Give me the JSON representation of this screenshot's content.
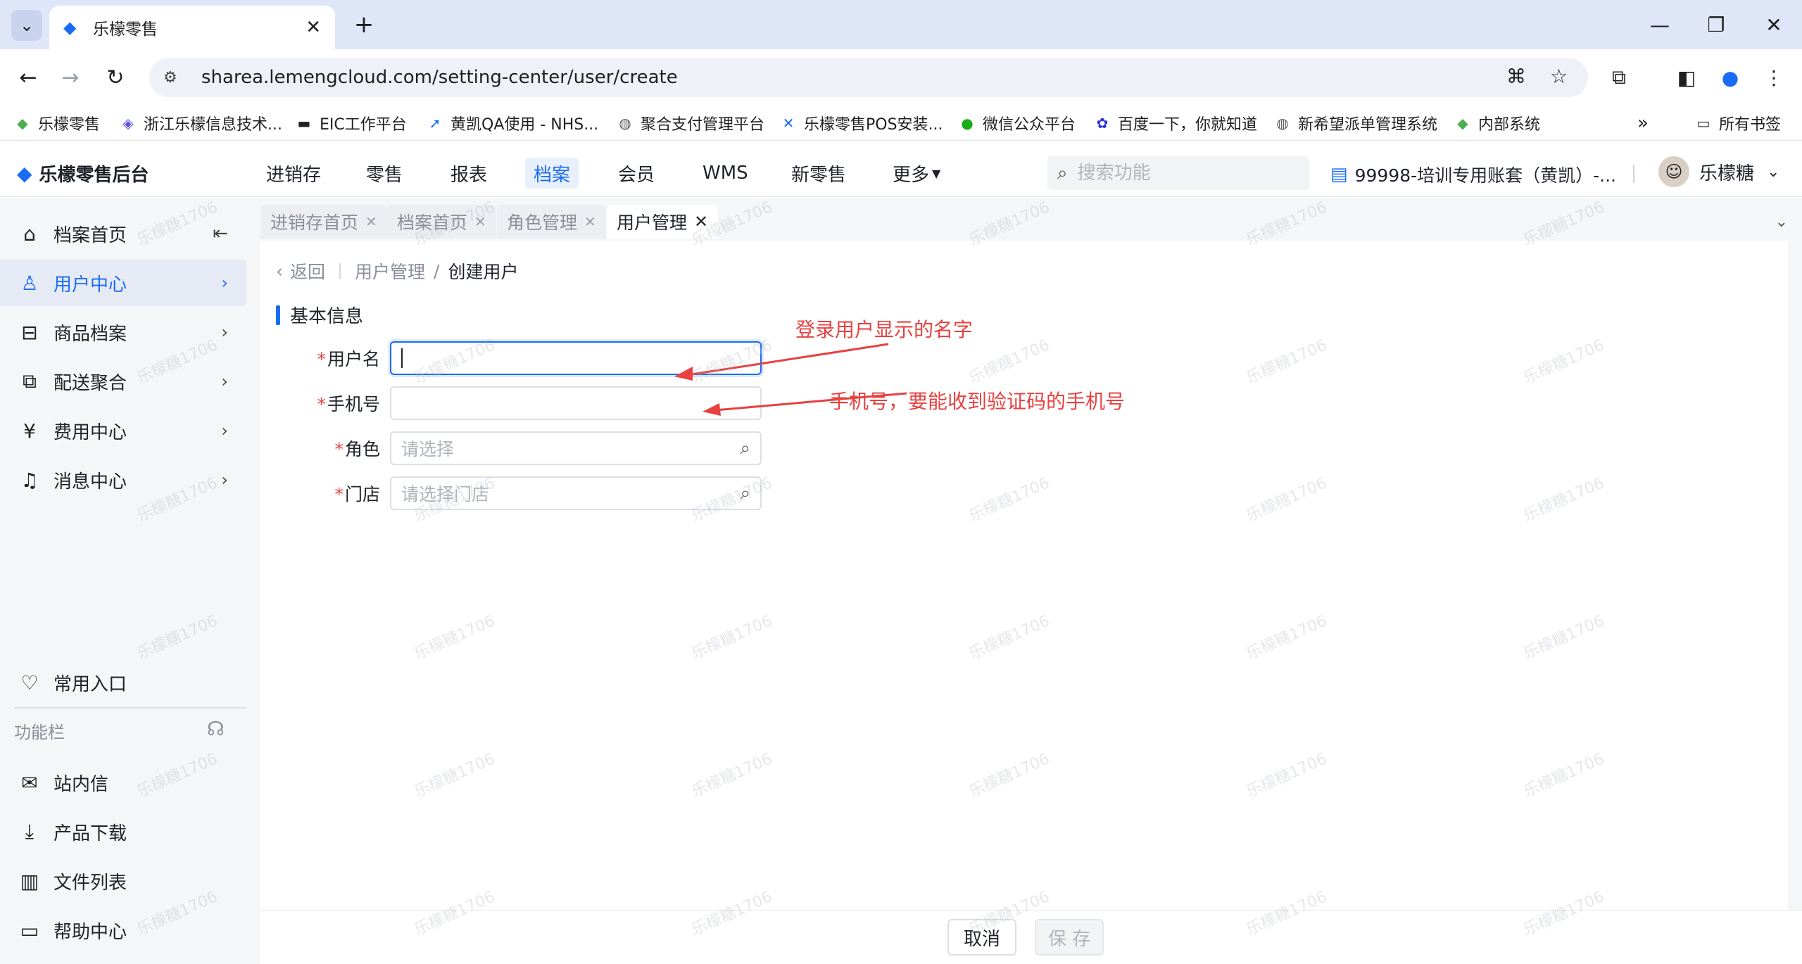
{
  "browser": {
    "tab_title": "乐檬零售",
    "url": "sharea.lemengcloud.com/setting-center/user/create",
    "bookmarks": [
      "乐檬零售",
      "浙江乐檬信息技术...",
      "EIC工作平台",
      "黄凯QA使用 - NHS...",
      "聚合支付管理平台",
      "乐檬零售POS安装...",
      "微信公众平台",
      "百度一下，你就知道",
      "新希望派单管理系统",
      "内部系统"
    ],
    "more_bookmarks": "»",
    "all_bookmarks": "所有书签"
  },
  "app": {
    "logo": "乐檬零售后台",
    "nav": [
      "进销存",
      "零售",
      "报表",
      "档案",
      "会员",
      "WMS",
      "新零售",
      "更多"
    ],
    "active_nav": "档案",
    "search_placeholder": "搜索功能",
    "account": "99998-培训专用账套（黄凯）-...",
    "username": "乐檬糖"
  },
  "sidebar": {
    "items": [
      {
        "label": "档案首页"
      },
      {
        "label": "用户中心"
      },
      {
        "label": "商品档案"
      },
      {
        "label": "配送聚合"
      },
      {
        "label": "费用中心"
      },
      {
        "label": "消息中心"
      }
    ],
    "favorites": "常用入口",
    "func_bar": "功能栏",
    "bottom": [
      {
        "label": "站内信"
      },
      {
        "label": "产品下载"
      },
      {
        "label": "文件列表"
      },
      {
        "label": "帮助中心"
      }
    ]
  },
  "page_tabs": [
    "进销存首页",
    "档案首页",
    "角色管理",
    "用户管理"
  ],
  "breadcrumb": {
    "back": "返回",
    "parent": "用户管理",
    "sep": "/",
    "current": "创建用户"
  },
  "section_title": "基本信息",
  "form": {
    "required_mark": "*",
    "username_label": "用户名",
    "phone_label": "手机号",
    "role_label": "角色",
    "role_placeholder": "请选择",
    "store_label": "门店",
    "store_placeholder": "请选择门店"
  },
  "annotations": {
    "username_note": "登录用户显示的名字",
    "phone_note": "手机号，要能收到验证码的手机号"
  },
  "footer": {
    "cancel": "取消",
    "save": "保 存"
  },
  "watermark": "乐檬糖1706",
  "colors": {
    "accent": "#1a6cf6",
    "required": "#e8413f",
    "annotation": "#e8413f"
  }
}
